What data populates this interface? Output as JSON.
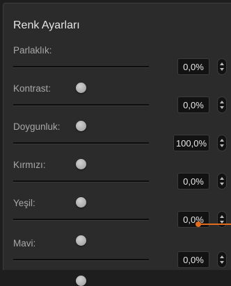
{
  "panel": {
    "title": "Renk Ayarları"
  },
  "sliders": [
    {
      "label": "Parlaklık:",
      "value": "0,0%",
      "level": 0.5
    },
    {
      "label": "Kontrast:",
      "value": "0,0%",
      "level": 0.5
    },
    {
      "label": "Doygunluk:",
      "value": "100,0%",
      "level": 0.5
    },
    {
      "label": "Kırmızı:",
      "value": "0,0%",
      "level": 0.5
    },
    {
      "label": "Yeşil:",
      "value": "0,0%",
      "level": 0.5
    },
    {
      "label": "Mavi:",
      "value": "0,0%",
      "level": 0.5
    }
  ],
  "colors": {
    "panel_background": "#2b2b2b",
    "callout_accent": "#e36b1c",
    "knob": "#b5b5b5"
  },
  "icons": {
    "stepper": "up-down-chevron-icon"
  }
}
